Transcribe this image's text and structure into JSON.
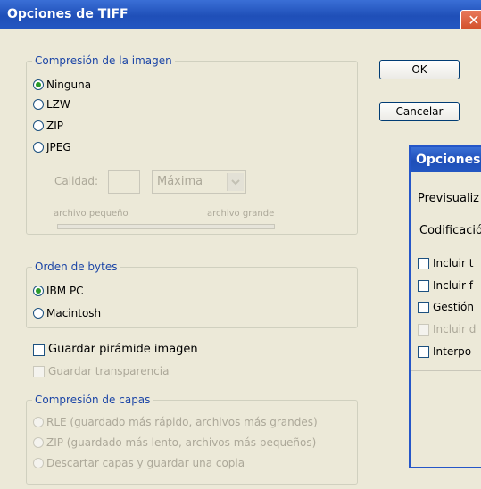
{
  "window": {
    "title": "Opciones de TIFF",
    "close_glyph": "✕"
  },
  "compression": {
    "legend": "Compresión de la imagen",
    "options": [
      "Ninguna",
      "LZW",
      "ZIP",
      "JPEG"
    ],
    "selected": "Ninguna",
    "quality_label": "Calidad:",
    "quality_value": "",
    "quality_preset": "Máxima",
    "small_file_label": "archivo pequeño",
    "large_file_label": "archivo grande"
  },
  "byte_order": {
    "legend": "Orden de bytes",
    "options": [
      "IBM PC",
      "Macintosh"
    ],
    "selected": "IBM PC"
  },
  "checkboxes": {
    "save_pyramid": "Guardar pirámide imagen",
    "save_transparency": "Guardar transparencia"
  },
  "layer_compression": {
    "legend": "Compresión de capas",
    "options": [
      "RLE (guardado más rápido, archivos más grandes)",
      "ZIP (guardado más lento, archivos más pequeños)",
      "Descartar capas y guardar una copia"
    ]
  },
  "buttons": {
    "ok": "OK",
    "cancel": "Cancelar"
  },
  "background_window": {
    "title": "Opciones",
    "preview_label": "Previsualiz",
    "encoding_label": "Codificació",
    "items": [
      "Incluir t",
      "Incluir f",
      "Gestión",
      "Incluir d",
      "Interpo"
    ]
  }
}
